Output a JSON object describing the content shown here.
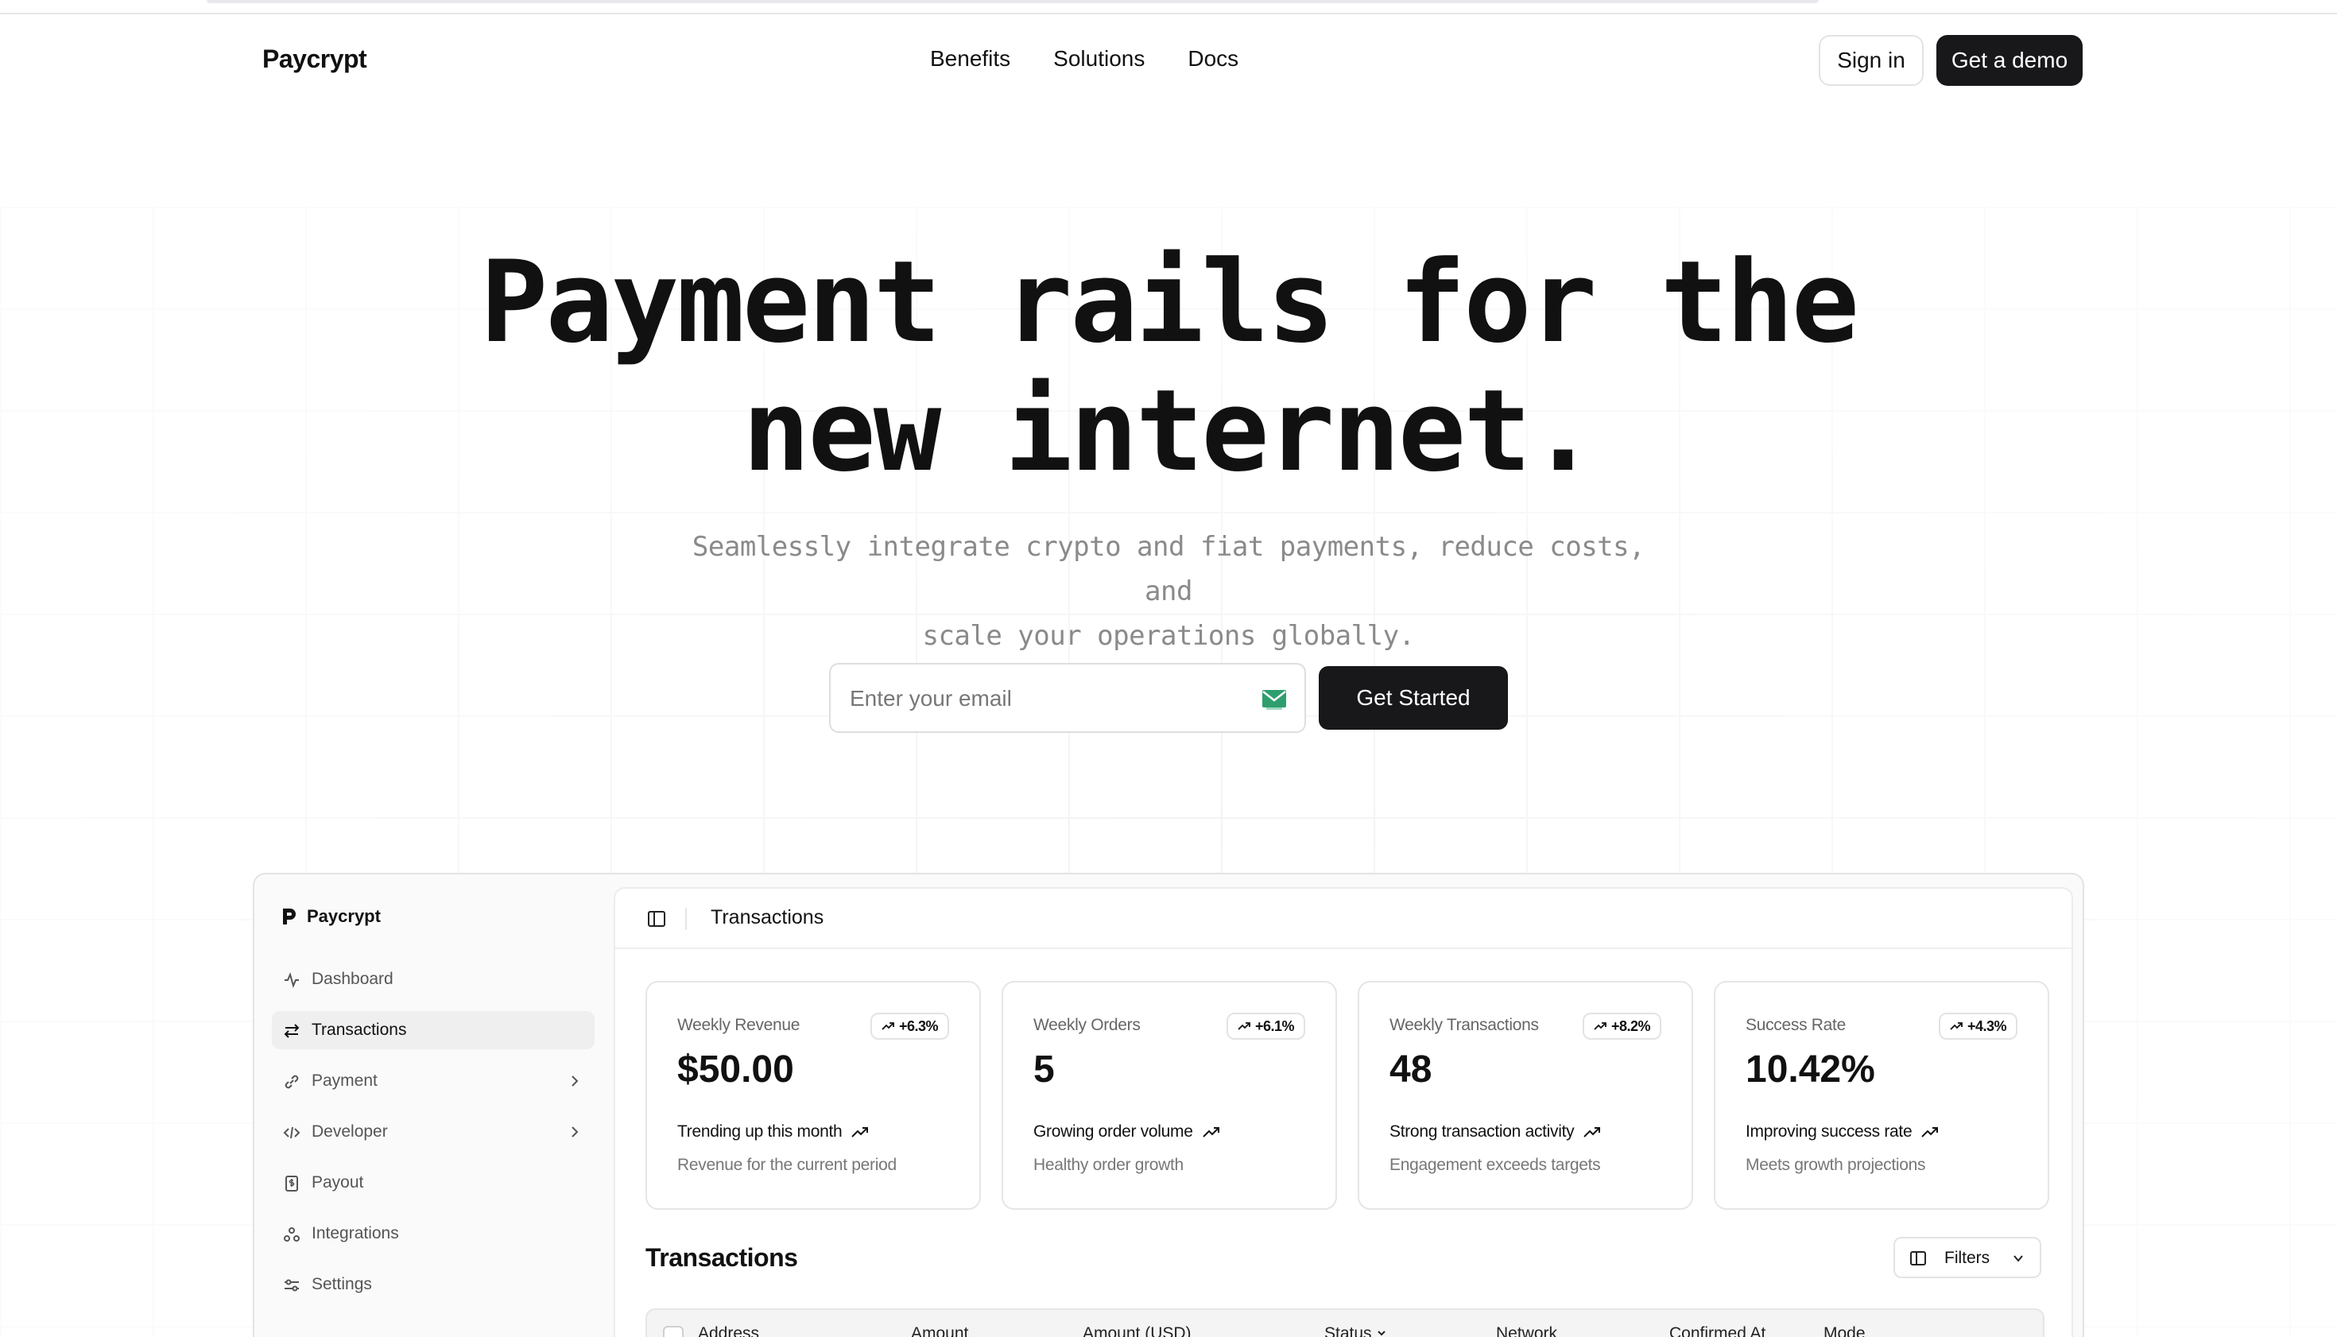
{
  "header": {
    "logo": "Paycrypt",
    "nav": [
      "Benefits",
      "Solutions",
      "Docs"
    ],
    "sign_in": "Sign in",
    "get_demo": "Get a demo"
  },
  "hero": {
    "title_line1": "Payment rails for the",
    "title_line2": "new internet.",
    "subtitle_line1": "Seamlessly integrate crypto and fiat payments, reduce costs, and",
    "subtitle_line2": "scale your operations globally.",
    "email_placeholder": "Enter your email",
    "cta": "Get Started"
  },
  "app": {
    "sidebar": {
      "logo": "Paycrypt",
      "items": [
        {
          "label": "Dashboard",
          "icon": "activity-icon"
        },
        {
          "label": "Transactions",
          "icon": "arrows-icon",
          "active": true
        },
        {
          "label": "Payment",
          "icon": "link-icon",
          "expandable": true
        },
        {
          "label": "Developer",
          "icon": "code-icon",
          "expandable": true
        },
        {
          "label": "Payout",
          "icon": "dollar-file-icon"
        },
        {
          "label": "Integrations",
          "icon": "webhook-icon"
        },
        {
          "label": "Settings",
          "icon": "sliders-icon"
        }
      ]
    },
    "topbar": {
      "title": "Transactions"
    },
    "cards": [
      {
        "label": "Weekly Revenue",
        "badge": "+6.3%",
        "value": "$50.00",
        "trend": "Trending up this month",
        "sub": "Revenue for the current period"
      },
      {
        "label": "Weekly Orders",
        "badge": "+6.1%",
        "value": "5",
        "trend": "Growing order volume",
        "sub": "Healthy order growth"
      },
      {
        "label": "Weekly Transactions",
        "badge": "+8.2%",
        "value": "48",
        "trend": "Strong transaction activity",
        "sub": "Engagement exceeds targets"
      },
      {
        "label": "Success Rate",
        "badge": "+4.3%",
        "value": "10.42%",
        "trend": "Improving success rate",
        "sub": "Meets growth projections"
      }
    ],
    "table": {
      "title": "Transactions",
      "filters": "Filters",
      "columns": [
        "Address",
        "Amount",
        "Amount (USD)",
        "Status",
        "Network",
        "Confirmed At",
        "Mode"
      ]
    }
  },
  "colors": {
    "primary": "#18181b",
    "email_icon": "#2f9e6f"
  }
}
